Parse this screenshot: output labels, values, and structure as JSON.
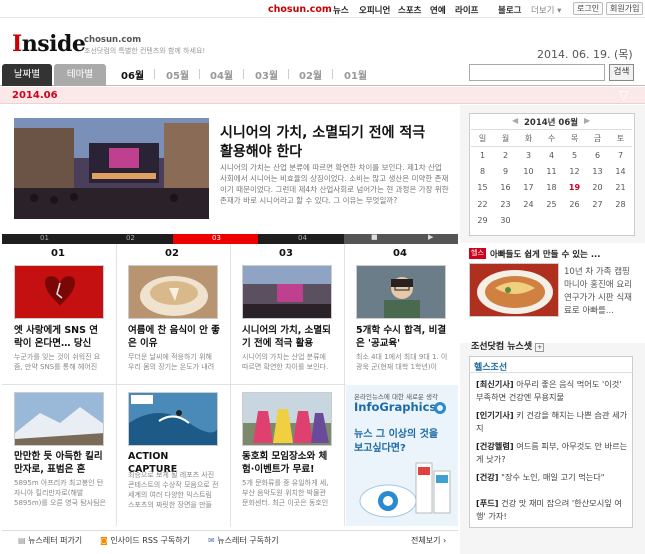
{
  "topnav": {
    "brand": "chosun.com",
    "links": [
      "뉴스",
      "오피니언",
      "스포츠",
      "연예",
      "라이프"
    ],
    "blog": "블로그",
    "more": "더보기",
    "login": "로그인",
    "join": "회원가입"
  },
  "header": {
    "logo": "Inside",
    "sub_domain": "chosun.com",
    "tagline": "조선닷컴의 특별한 컨텐츠와 함께 하세요!",
    "date": "2014. 06. 19. (목)",
    "search_placeholder": "",
    "search_button": "검색"
  },
  "tabs": {
    "by_date": "날짜별",
    "by_theme": "테마별"
  },
  "months": [
    "06월",
    "05월",
    "04월",
    "03월",
    "02월",
    "01월"
  ],
  "current_month_label": "2014.06",
  "featured": {
    "title": "시니어의 가치, 소멸되기 전에 적극 활용해야 한다",
    "desc": "시니어의 가치는 산업 분류에 따르면 확연한 차이를 보인다. 제1차 산업 사회에서 시니어는 비효율의 상징이었다. 소비는 많고 생산은 미약한 존재이기 때문이었다. 그런데 제4차 산업사회로 넘어가는 현 과정은 가장 위한 존재가 바로 시니어라고 할 수 있다. 그 이유는 무엇일까?"
  },
  "pager": [
    "01",
    "02",
    "03",
    "04"
  ],
  "pager_active": 2,
  "columns": [
    {
      "num": "01",
      "title": "엣 사랑에게 SNS 연락이 온다면… 당신",
      "sub": "누군가를 잊는 것이 쉬워진 요즘, 만약 SNS를 통해 헤어진"
    },
    {
      "num": "02",
      "title": "여름에 찬 음식이 안 좋은 이유",
      "sub": "무더운 날씨에 적응하기 위해 우리 몸의 장기는 온도가 내려"
    },
    {
      "num": "03",
      "title": "시니어의 가치, 소멸되기 전에 적극 활용",
      "sub": "시니어의 가치는 산업 분류에 따르면 확연한 차이를 보인다."
    },
    {
      "num": "04",
      "title": "5개학 수시 합격, 비결은 '공교육'",
      "sub": "최소 4대 1에서 최대 9대 1. 이광욱 군(현재 대학 1학년)이"
    }
  ],
  "row2": [
    {
      "title": "만만한 듯 아득한 킬리만자로, 표범은 흔",
      "sub": "5895m 아프리카 최고봉인 탄자니아 킬리만자로(해발 5895m)를 오른 영국 탐사팀은"
    },
    {
      "title": "ACTION CAPTURE",
      "sub": "최승으로 보게 될 레포츠 사진 콘테스트의 수상작 모음으로 전 세계의 여러 다양한 익스트림 스포츠의 짜릿한 장면을 만들"
    },
    {
      "title": "동호회 모임장소와 체험·이벤트가 무료!",
      "sub": "5개 문화류를 중 유일하게 세, 부산 음악도원 위치한 박물관 문화센터. 최근 이곳은 동호인들"
    }
  ],
  "ad": {
    "top": "온라인뉴스에 대한 새로운 생각",
    "brand": "InfoGraphics",
    "headline": "뉴스 그 이상의 것을",
    "headline2": "보고싶다면?"
  },
  "footer": {
    "newsletter_read": "뉴스레터 퍼가기",
    "rss": "인사이드 RSS 구독하기",
    "newsletter_sub": "뉴스레터 구독하기",
    "all": "전체보기"
  },
  "calendar": {
    "title": "2014년 06월",
    "weekdays": [
      "일",
      "월",
      "화",
      "수",
      "목",
      "금",
      "토"
    ],
    "weeks": [
      [
        "1",
        "2",
        "3",
        "4",
        "5",
        "6",
        "7"
      ],
      [
        "8",
        "9",
        "10",
        "11",
        "12",
        "13",
        "14"
      ],
      [
        "15",
        "16",
        "17",
        "18",
        "19",
        "20",
        "21"
      ],
      [
        "22",
        "23",
        "24",
        "25",
        "26",
        "27",
        "28"
      ],
      [
        "29",
        "30",
        "",
        "",
        "",
        "",
        ""
      ]
    ],
    "highlight": "19"
  },
  "promo": {
    "tag": "헬스",
    "title": "아빠들도 쉽게 만들 수 있는 ...",
    "text": "10년 차 가족 캠핑 마니아 홍진애 요리연구가가 시판 식재료로 아빠를..."
  },
  "news_set": {
    "title": "조선닷컴 뉴스셋",
    "tab": "헬스조선",
    "items": [
      {
        "tag": "[최신기사]",
        "text": "아무리 좋은 음식 먹어도 '이것' 부족하면 건강엔 무용지물"
      },
      {
        "tag": "[인기기사]",
        "text": "키 건강을 해치는 나쁜 습관 세가지"
      },
      {
        "tag": "[건강헬렴]",
        "text": "여드름 피부, 아무것도 안 바르는 게 낫가?"
      },
      {
        "tag": "[건강]",
        "text": "\"장수 노인, 매일 고기 먹는다\""
      },
      {
        "tag": "[푸드]",
        "text": "건강 맛 재미 잡으려 '한산모시잎 여행' 가자!"
      }
    ]
  },
  "colors": {
    "accent": "#d0021b",
    "month_bar": "#fbe9e9",
    "dark": "#222222"
  }
}
